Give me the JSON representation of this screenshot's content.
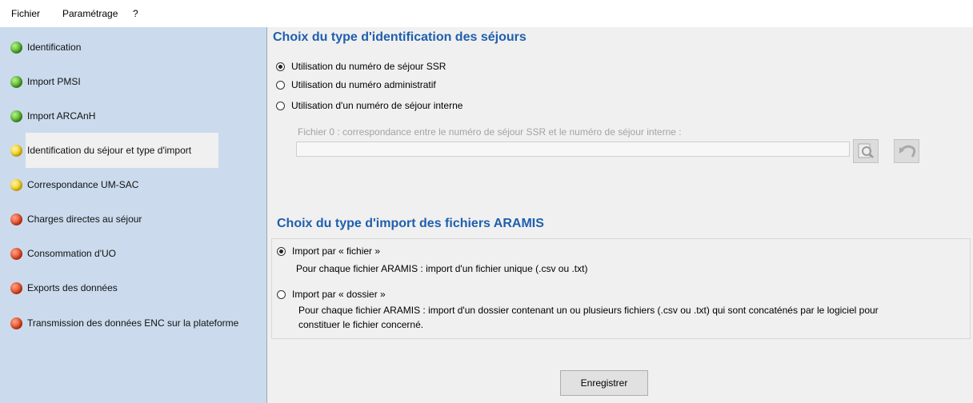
{
  "menu": {
    "items": [
      "Fichier",
      "Paramétrage",
      "?"
    ]
  },
  "sidebar": {
    "items": [
      {
        "label": "Identification",
        "status": "green"
      },
      {
        "label": "Import PMSI",
        "status": "green"
      },
      {
        "label": "Import ARCAnH",
        "status": "green"
      },
      {
        "label": "Identification du séjour et type d'import",
        "status": "yellow"
      },
      {
        "label": "Correspondance UM-SAC",
        "status": "yellow"
      },
      {
        "label": "Charges directes au séjour",
        "status": "red"
      },
      {
        "label": "Consommation d'UO",
        "status": "red"
      },
      {
        "label": "Exports des données",
        "status": "red"
      },
      {
        "label": "Transmission des données ENC sur la plateforme",
        "status": "red"
      }
    ],
    "selected_index": 3
  },
  "identification": {
    "title": "Choix du type d'identification des séjours",
    "options": [
      {
        "label": "Utilisation du numéro de séjour SSR",
        "checked": true
      },
      {
        "label": "Utilisation du numéro administratif",
        "checked": false
      },
      {
        "label": "Utilisation d'un numéro de séjour interne",
        "checked": false
      }
    ],
    "file_label": "Fichier 0 : correspondance entre le numéro de séjour SSR et le numéro de séjour interne :",
    "file_value": ""
  },
  "import_type": {
    "title": "Choix du type d'import des fichiers ARAMIS",
    "options": [
      {
        "label": "Import par « fichier »",
        "checked": true,
        "desc": "Pour chaque fichier ARAMIS : import d'un fichier unique (.csv ou .txt)"
      },
      {
        "label": "Import par « dossier »",
        "checked": false,
        "desc_line1": "Pour chaque fichier ARAMIS : import d'un dossier contenant un ou plusieurs fichiers (.csv ou .txt) qui sont concaténés par le logiciel pour",
        "desc_line2": "constituer le fichier concerné."
      }
    ]
  },
  "save_label": "Enregistrer",
  "colors": {
    "title": "#1f5fae",
    "sidebar_bg": "#cbdbed",
    "main_bg": "#f0f0f0"
  }
}
